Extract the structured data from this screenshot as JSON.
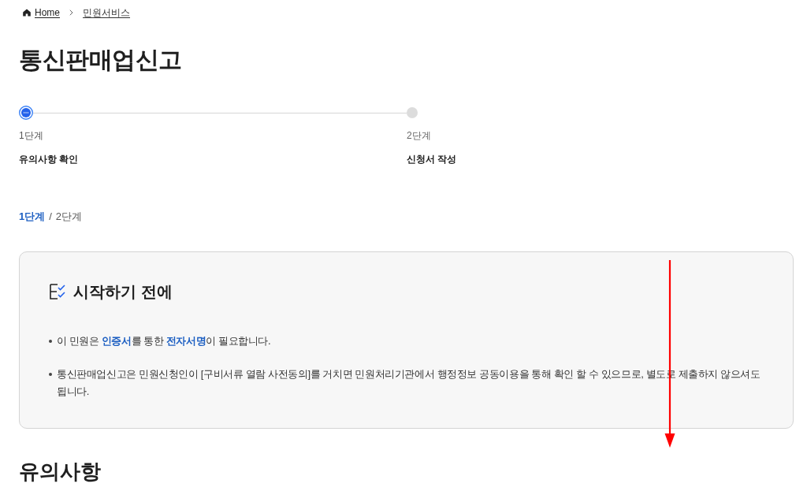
{
  "breadcrumb": [
    {
      "kind": "home",
      "label": "Home"
    },
    {
      "kind": "link",
      "label": "민원서비스"
    }
  ],
  "page_title": "통신판매업신고",
  "steps": [
    {
      "number": "1단계",
      "label": "유의사항 확인",
      "selected": true
    },
    {
      "number": "2단계",
      "label": "신청서 작성",
      "selected": false
    }
  ],
  "step_counter": {
    "current": "1단계",
    "separator": "/",
    "total": "2단계"
  },
  "notice_box": {
    "title": "시작하기 전에",
    "items": [
      "이 민원은 **인증서**를 통한 **전자서명**이 필요합니다.",
      "통신판매업신고은 민원신청인이 [구비서류 열람 사전동의]를 거치면 민원처리기관에서 행정정보 공동이용을 통해 확인 할 수 있으므로, 별도로 제출하지 않으셔도 됩니다."
    ]
  },
  "section_title": "유의사항"
}
